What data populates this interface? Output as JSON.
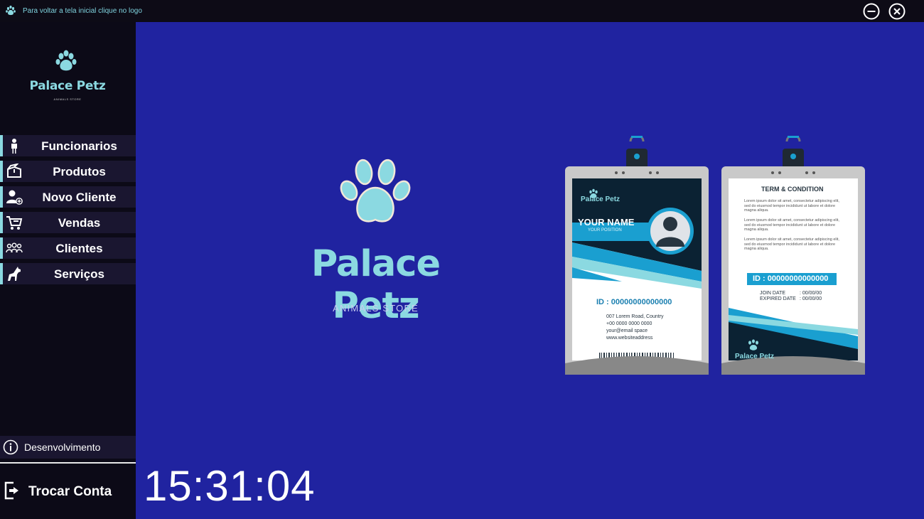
{
  "titlebar": {
    "hint": "Para voltar a tela inicial clique no logo",
    "minimize_icon": "minus-circle-icon",
    "close_icon": "x-circle-icon"
  },
  "logo": {
    "name": "Palace Petz",
    "subtitle": "ANIMALS STORE",
    "icon": "paw-icon"
  },
  "nav": {
    "items": [
      {
        "label": "Funcionarios",
        "icon": "person-icon"
      },
      {
        "label": "Produtos",
        "icon": "box-icon"
      },
      {
        "label": "Novo Cliente",
        "icon": "add-user-icon"
      },
      {
        "label": "Vendas",
        "icon": "cart-icon"
      },
      {
        "label": "Clientes",
        "icon": "group-icon"
      },
      {
        "label": "Serviços",
        "icon": "dog-icon"
      }
    ]
  },
  "footer": {
    "dev_label": "Desenvolvimento",
    "dev_icon": "info-icon",
    "logout_label": "Trocar Conta",
    "logout_icon": "logout-icon"
  },
  "main": {
    "brand_name": "Palace Petz",
    "brand_subtitle": "ANIMALS STORE",
    "clock": "15:31:04"
  },
  "badge_front": {
    "brand": "Palace Petz",
    "name": "YOUR NAME",
    "position": "YOUR POSITION",
    "id": "ID : 00000000000000",
    "address": "007 Lorem Road, Country",
    "phone": "+00 0000 0000 0000",
    "email": "your@email space",
    "web": "www.websiteaddress"
  },
  "badge_back": {
    "heading": "TERM & CONDITION",
    "terms": [
      "Lorem ipsum dolor sit amet, consectetur adipiscing elit, sed do eiusmod tempor incididunt ut labore et dolore magna aliqua.",
      "Lorem ipsum dolor sit amet, consectetur adipiscing elit, sed do eiusmod tempor incididunt ut labore et dolore magna aliqua.",
      "Lorem ipsum dolor sit amet, consectetur adipiscing elit, sed do eiusmod tempor incididunt ut labore et dolore magna aliqua."
    ],
    "id": "ID : 00000000000000",
    "join_label": "JOIN DATE",
    "join_value": ": 00/00/00",
    "expired_label": "EXPIRED DATE",
    "expired_value": ": 00/00/00",
    "brand": "Palace Petz"
  },
  "colors": {
    "accent": "#8bd9e1",
    "main_bg": "#2023a0",
    "sidebar_bg": "#0c0a17",
    "nav_bg": "#1a1630",
    "badge_teal": "#1a9fd0",
    "badge_dark": "#0b2233"
  }
}
